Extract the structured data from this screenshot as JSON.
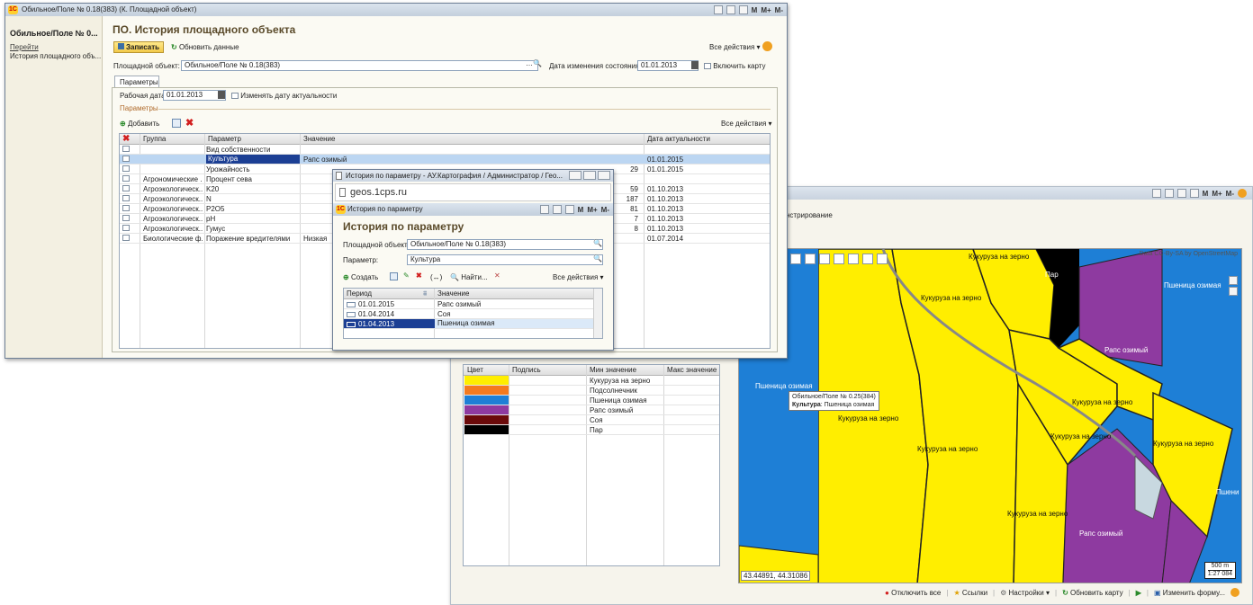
{
  "main": {
    "title_bar": "Обильное/Поле № 0.18(383) (К. Площадной объект)",
    "title_btns": [
      "M",
      "M+",
      "M-"
    ],
    "sidebar": {
      "heading": "Обильное/Поле № 0...",
      "goto": "Перейти",
      "item": "История площадного объ..."
    },
    "page_title": "ПО. История площадного объекта",
    "save": "Записать",
    "refresh": "Обновить данные",
    "all_actions": "Все действия",
    "obj_label": "Площадной объект:",
    "obj_value": "Обильное/Поле № 0.18(383)",
    "date_label": "Дата изменения состояния:",
    "date_value": "01.01.2013",
    "map_check": "Включить карту",
    "tab": "Параметры",
    "work_date_label": "Рабочая дата:",
    "work_date": "01.01.2013",
    "change_date": "Изменять дату актуальности",
    "section": "Параметры",
    "add": "Добавить",
    "all_actions2": "Все действия",
    "cols": [
      "Группа",
      "Параметр",
      "Значение",
      "Дата актуальности"
    ],
    "rows": [
      {
        "g": "",
        "p": "Вид собственности",
        "v": "",
        "n": "",
        "d": ""
      },
      {
        "g": "",
        "p": "Культура",
        "v": "Рапс озимый",
        "n": "",
        "d": "01.01.2015"
      },
      {
        "g": "",
        "p": "Урожайность",
        "v": "",
        "n": "29",
        "d": "01.01.2015"
      },
      {
        "g": "Агрономические ...",
        "p": "Процент сева",
        "v": "",
        "n": "",
        "d": ""
      },
      {
        "g": "Агроэкологическ...",
        "p": "K20",
        "v": "",
        "n": "59",
        "d": "01.10.2013"
      },
      {
        "g": "Агроэкологическ...",
        "p": "N",
        "v": "",
        "n": "187",
        "d": "01.10.2013"
      },
      {
        "g": "Агроэкологическ...",
        "p": "P2O5",
        "v": "",
        "n": "81",
        "d": "01.10.2013"
      },
      {
        "g": "Агроэкологическ...",
        "p": "pH",
        "v": "",
        "n": "7",
        "d": "01.10.2013"
      },
      {
        "g": "Агроэкологическ...",
        "p": "Гумус",
        "v": "",
        "n": "8",
        "d": "01.10.2013"
      },
      {
        "g": "Биологические ф...",
        "p": "Поражение вредителями",
        "v": "Низкая",
        "n": "",
        "d": "01.07.2014"
      }
    ]
  },
  "popup": {
    "browser_title": "История по параметру - АУ.Картография / Администратор / Гео...",
    "url": "geos.1cps.ru",
    "win_title": "История по параметру",
    "title_btns": [
      "M",
      "M+",
      "M-"
    ],
    "heading": "История по параметру",
    "obj_label": "Площадной объект:",
    "obj_value": "Обильное/Поле № 0.18(383)",
    "param_label": "Параметр:",
    "param_value": "Культура",
    "create": "Создать",
    "find": "Найти...",
    "all_actions": "Все действия",
    "cols": [
      "Период",
      "Значение"
    ],
    "rows": [
      {
        "p": "01.01.2015",
        "v": "Рапс озимый"
      },
      {
        "p": "01.04.2014",
        "v": "Соя"
      },
      {
        "p": "01.04.2013",
        "v": "Пшеница озимая"
      }
    ]
  },
  "map_win": {
    "title_btns": [
      "M",
      "M+",
      "M-"
    ],
    "tab_fragment": "нстрирование",
    "legend_cols": [
      "Цвет",
      "Подпись",
      "Мин значение",
      "Макс значение"
    ],
    "legend": [
      {
        "color": "#ffee00",
        "min": "Кукуруза на зерно"
      },
      {
        "color": "#f57a1e",
        "min": "Подсолнечник"
      },
      {
        "color": "#1e7fd6",
        "min": "Пшеница озимая"
      },
      {
        "color": "#8e3aa0",
        "min": "Рапс озимый"
      },
      {
        "color": "#6b0a0a",
        "min": "Соя"
      },
      {
        "color": "#000000",
        "min": "Пар"
      }
    ],
    "attribution": "Data CC-By-SA by OpenStreetMap",
    "map_labels": [
      "Кукуруза на зерно",
      "Пар",
      "Кукуруза на зерно",
      "Пшеница озимая",
      "Рапс озимый",
      "Пшеница озимая",
      "Кукуруза на зерно",
      "Кукуруза на зерно",
      "Кукуруза на зерно",
      "Кукуруза на зерно",
      "Кукуруза на зерно",
      "Кукуруза на зерно",
      "Рапс озимый",
      "Пшени"
    ],
    "tooltip_title": "Обильное/Поле № 0.25(384)",
    "tooltip_key": "Культура",
    "tooltip_val": ": Пшеница озимая",
    "coords": "43.44891, 44.31086",
    "scale_dist": "500 m",
    "scale_ratio": "1:27 084",
    "bottom": [
      "Отключить все",
      "Ссылки",
      "Настройки",
      "Обновить карту",
      "Изменить форму..."
    ]
  }
}
